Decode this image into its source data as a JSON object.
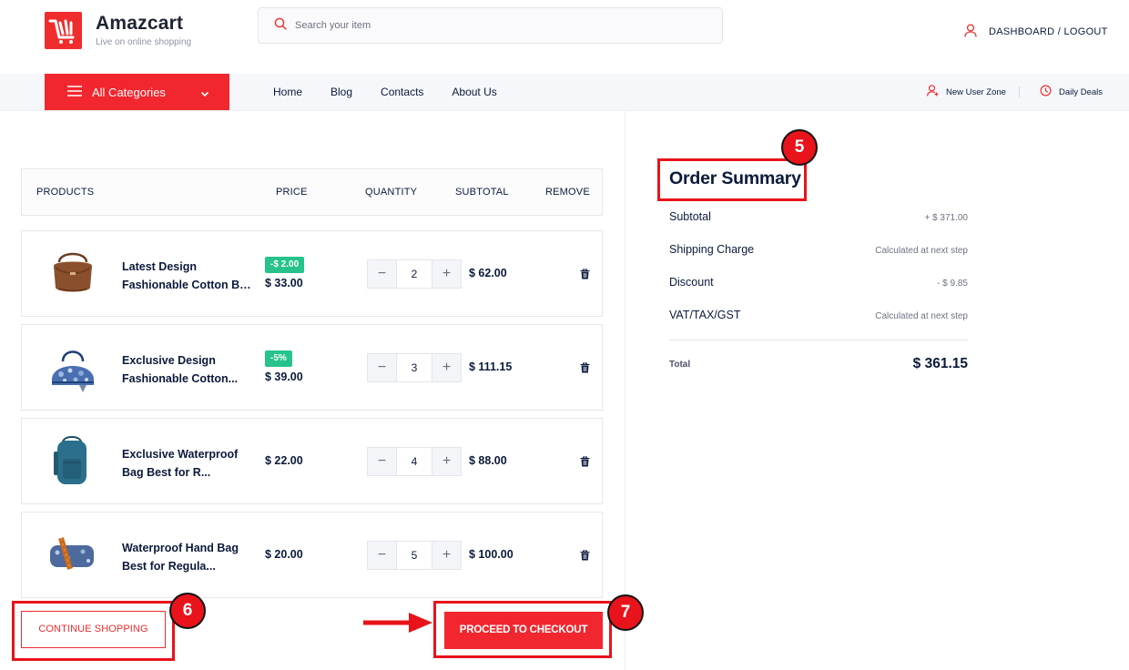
{
  "brand": {
    "name": "Amazcart",
    "tagline": "Live on online shopping"
  },
  "search": {
    "placeholder": "Search your item"
  },
  "header": {
    "account_link": "DASHBOARD / LOGOUT"
  },
  "nav": {
    "all_categories": "All Categories",
    "menu": [
      "Home",
      "Blog",
      "Contacts",
      "About Us"
    ],
    "right_links": [
      "New User Zone",
      "Daily Deals"
    ]
  },
  "cart": {
    "headers": {
      "products": "PRODUCTS",
      "price": "PRICE",
      "quantity": "QUANTITY",
      "subtotal": "SUBTOTAL",
      "remove": "REMOVE"
    },
    "items": [
      {
        "name_line1": "Latest Design",
        "name_line2": "Fashionable Cotton Ba...",
        "discount": "-$ 2.00",
        "price": "$ 33.00",
        "qty": "2",
        "subtotal": "$ 62.00",
        "image": "brown-handbag"
      },
      {
        "name_line1": "Exclusive Design",
        "name_line2": "Fashionable Cotton...",
        "discount": "-5%",
        "price": "$ 39.00",
        "qty": "3",
        "subtotal": "$ 111.15",
        "image": "blue-floral-handbag"
      },
      {
        "name_line1": "Exclusive Waterproof",
        "name_line2": "Bag Best for R...",
        "discount": "",
        "price": "$ 22.00",
        "qty": "4",
        "subtotal": "$ 88.00",
        "image": "teal-backpack"
      },
      {
        "name_line1": "Waterproof Hand Bag",
        "name_line2": "Best for Regula...",
        "discount": "",
        "price": "$ 20.00",
        "qty": "5",
        "subtotal": "$ 100.00",
        "image": "floral-crossbody-bag"
      }
    ],
    "continue_label": "CONTINUE SHOPPING",
    "checkout_label": "PROCEED TO CHECKOUT"
  },
  "summary": {
    "title": "Order Summary",
    "rows": [
      {
        "label": "Subtotal",
        "value": "+ $ 371.00"
      },
      {
        "label": "Shipping Charge",
        "value": "Calculated at next step"
      },
      {
        "label": "Discount",
        "value": "- $ 9.85"
      },
      {
        "label": "VAT/TAX/GST",
        "value": "Calculated at next step"
      }
    ],
    "total_label": "Total",
    "total_value": "$ 361.15"
  },
  "annotations": {
    "step5": "5",
    "step6": "6",
    "step7": "7"
  },
  "colors": {
    "accent": "#f2262e",
    "badge": "#27c38a",
    "text": "#0b1a3b",
    "highlight": "#e8131b"
  }
}
